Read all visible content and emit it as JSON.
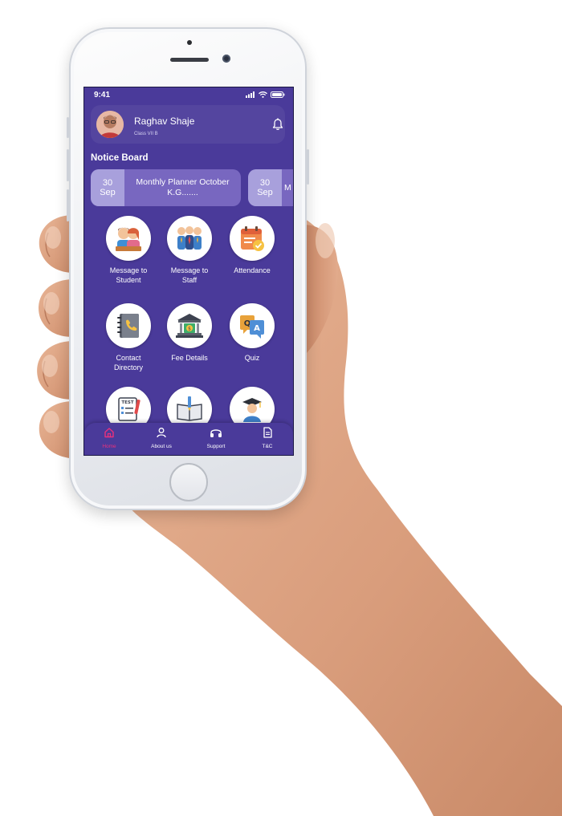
{
  "status_bar": {
    "time": "9:41"
  },
  "profile": {
    "name": "Raghav Shaje",
    "class": "Class VII B"
  },
  "notice_board": {
    "title": "Notice Board",
    "items": [
      {
        "day": "30",
        "month": "Sep",
        "line1": "Monthly Planner October",
        "line2": "K.G......."
      },
      {
        "day": "30",
        "month": "Sep",
        "line1": "M",
        "line2": ""
      }
    ]
  },
  "tiles": [
    {
      "line1": "Message to",
      "line2": "Student",
      "icon": "students-icon"
    },
    {
      "line1": "Message to",
      "line2": "Staff",
      "icon": "staff-icon"
    },
    {
      "line1": "Attendance",
      "line2": "",
      "icon": "attendance-calendar-icon"
    },
    {
      "line1": "Contact",
      "line2": "Directory",
      "icon": "contact-book-icon"
    },
    {
      "line1": "Fee Details",
      "line2": "",
      "icon": "bank-fee-icon"
    },
    {
      "line1": "Quiz",
      "line2": "",
      "icon": "quiz-qa-icon"
    },
    {
      "line1": "",
      "line2": "",
      "icon": "test-paper-icon"
    },
    {
      "line1": "",
      "line2": "",
      "icon": "book-pen-icon"
    },
    {
      "line1": "",
      "line2": "",
      "icon": "graduate-icon"
    }
  ],
  "bottom_nav": [
    {
      "label": "Home",
      "icon": "home-icon",
      "active": true
    },
    {
      "label": "About us",
      "icon": "person-icon",
      "active": false
    },
    {
      "label": "Support",
      "icon": "headphones-icon",
      "active": false
    },
    {
      "label": "T&C",
      "icon": "document-icon",
      "active": false
    }
  ],
  "colors": {
    "screen_bg": "#4a3a9a",
    "notice_card": "#7867c0",
    "notice_date": "#a8a0dc",
    "active_nav": "#e9317c"
  }
}
